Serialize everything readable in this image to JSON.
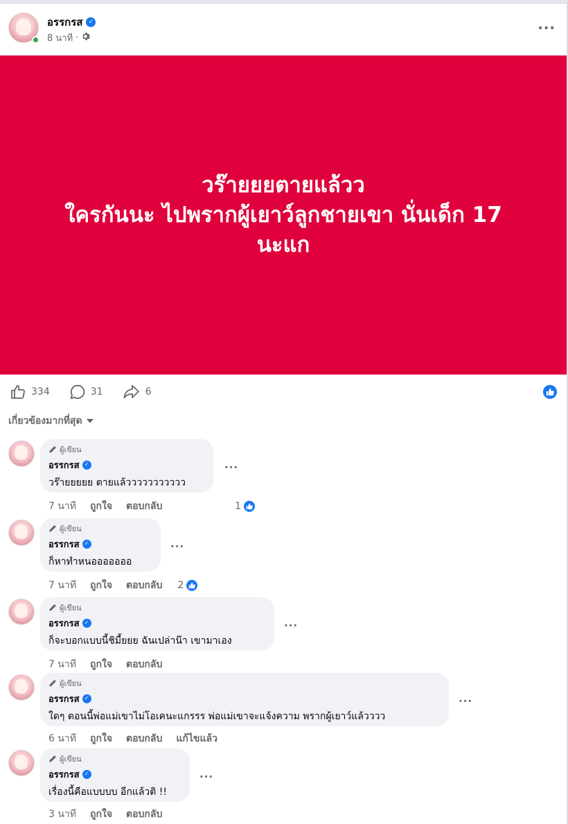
{
  "post": {
    "author": "อรรกรส",
    "time": "8 นาที",
    "banner_lines": [
      "วร๊ายยยตายแล้วว",
      "ใครกันนะ ไปพรากผู้เยาว์ลูกชายเขา นั่นเด็ก 17",
      "นะแก"
    ],
    "banner_color": "#e0003c"
  },
  "stats": {
    "likes": "334",
    "comments": "31",
    "shares": "6"
  },
  "sort_label": "เกี่ยวข้องมากที่สุด",
  "comments": [
    {
      "badge": "ผู้เขียน",
      "author": "อรรกรส",
      "text": "วร๊ายยยยย ตายแล้ววววววววววว",
      "time": "7 นาที",
      "like": "ถูกใจ",
      "reply": "ตอบกลับ",
      "reactions": "1",
      "edited": ""
    },
    {
      "badge": "ผู้เขียน",
      "author": "อรรกรส",
      "text": "ก็หาทำหนอออออออ",
      "time": "7 นาที",
      "like": "ถูกใจ",
      "reply": "ตอบกลับ",
      "reactions": "2",
      "edited": ""
    },
    {
      "badge": "ผู้เขียน",
      "author": "อรรกรส",
      "text": "ก็จะบอกแบบนี้ชิมี้ยยย ฉันเปล่าน๊า เขามาเอง",
      "time": "7 นาที",
      "like": "ถูกใจ",
      "reply": "ตอบกลับ",
      "reactions": "",
      "edited": ""
    },
    {
      "badge": "ผู้เขียน",
      "author": "อรรกรส",
      "text": "ใดๆ ตอนนี้พ่อแม่เขาไม่โอเคนะแกรรร พ่อแม่เขาจะแจ้งความ พรากผู้เยาว์แล้วววว",
      "time": "6 นาที",
      "like": "ถูกใจ",
      "reply": "ตอบกลับ",
      "reactions": "",
      "edited": "แก้ไขแล้ว"
    },
    {
      "badge": "ผู้เขียน",
      "author": "อรรกรส",
      "text": "เรื่องนี้คือแบบบบ อีกแล้วติ !!",
      "time": "3 นาที",
      "like": "ถูกใจ",
      "reply": "ตอบกลับ",
      "reactions": "",
      "edited": ""
    }
  ],
  "icons": [
    "verified-icon",
    "settings-icon",
    "more-icon",
    "like-icon",
    "comment-icon",
    "share-icon",
    "pencil-icon",
    "caret-down-icon"
  ],
  "colors": {
    "accent": "#1877f2",
    "online": "#31a24c",
    "bubble": "#f0f2f5",
    "muted": "#65676b"
  }
}
